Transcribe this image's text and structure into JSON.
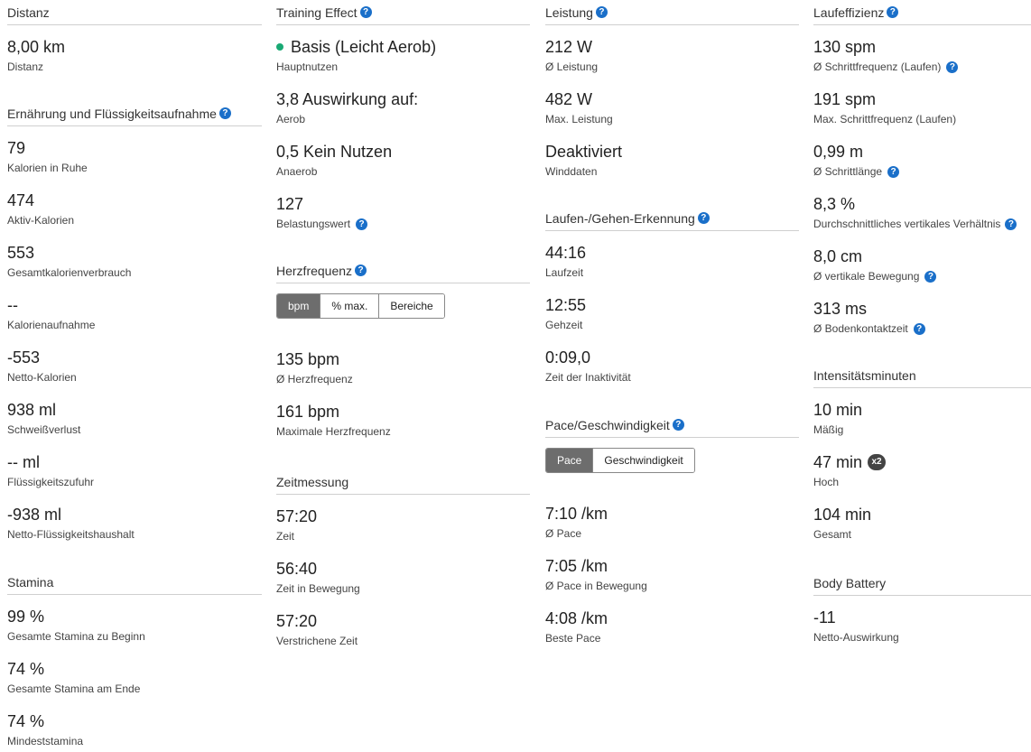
{
  "distanz": {
    "title": "Distanz",
    "items": [
      {
        "value": "8,00 km",
        "label": "Distanz"
      }
    ]
  },
  "ernaehrung": {
    "title": "Ernährung und Flüssigkeitsaufnahme",
    "items": [
      {
        "value": "79",
        "label": "Kalorien in Ruhe"
      },
      {
        "value": "474",
        "label": "Aktiv-Kalorien"
      },
      {
        "value": "553",
        "label": "Gesamtkalorienverbrauch"
      },
      {
        "value": "--",
        "label": "Kalorienaufnahme"
      },
      {
        "value": "-553",
        "label": "Netto-Kalorien"
      },
      {
        "value": "938 ml",
        "label": "Schweißverlust"
      },
      {
        "value": "-- ml",
        "label": "Flüssigkeitszufuhr"
      },
      {
        "value": "-938 ml",
        "label": "Netto-Flüssigkeitshaushalt"
      }
    ]
  },
  "stamina": {
    "title": "Stamina",
    "items": [
      {
        "value": "99 %",
        "label": "Gesamte Stamina zu Beginn"
      },
      {
        "value": "74 %",
        "label": "Gesamte Stamina am Ende"
      },
      {
        "value": "74 %",
        "label": "Mindeststamina"
      }
    ]
  },
  "training_effect": {
    "title": "Training Effect",
    "items": [
      {
        "value": "Basis (Leicht Aerob)",
        "label": "Hauptnutzen"
      },
      {
        "value": "3,8 Auswirkung auf:",
        "label": "Aerob"
      },
      {
        "value": "0,5 Kein Nutzen",
        "label": "Anaerob"
      },
      {
        "value": "127",
        "label": "Belastungswert"
      }
    ]
  },
  "herzfrequenz": {
    "title": "Herzfrequenz",
    "toggle": [
      "bpm",
      "% max.",
      "Bereiche"
    ],
    "items": [
      {
        "value": "135 bpm",
        "label": "Ø Herzfrequenz"
      },
      {
        "value": "161 bpm",
        "label": "Maximale Herzfrequenz"
      }
    ]
  },
  "zeitmessung": {
    "title": "Zeitmessung",
    "items": [
      {
        "value": "57:20",
        "label": "Zeit"
      },
      {
        "value": "56:40",
        "label": "Zeit in Bewegung"
      },
      {
        "value": "57:20",
        "label": "Verstrichene Zeit"
      }
    ]
  },
  "leistung": {
    "title": "Leistung",
    "items": [
      {
        "value": "212 W",
        "label": "Ø Leistung"
      },
      {
        "value": "482 W",
        "label": "Max. Leistung"
      },
      {
        "value": "Deaktiviert",
        "label": "Winddaten"
      }
    ]
  },
  "laufen_gehen": {
    "title": "Laufen-/Gehen-Erkennung",
    "items": [
      {
        "value": "44:16",
        "label": "Laufzeit"
      },
      {
        "value": "12:55",
        "label": "Gehzeit"
      },
      {
        "value": "0:09,0",
        "label": "Zeit der Inaktivität"
      }
    ]
  },
  "pace": {
    "title": "Pace/Geschwindigkeit",
    "toggle": [
      "Pace",
      "Geschwindigkeit"
    ],
    "items": [
      {
        "value": "7:10 /km",
        "label": "Ø Pace"
      },
      {
        "value": "7:05 /km",
        "label": "Ø Pace in Bewegung"
      },
      {
        "value": "4:08 /km",
        "label": "Beste Pace"
      }
    ]
  },
  "laufeffizienz": {
    "title": "Laufeffizienz",
    "items": [
      {
        "value": "130 spm",
        "label": "Ø Schrittfrequenz (Laufen)"
      },
      {
        "value": "191 spm",
        "label": "Max. Schrittfrequenz (Laufen)"
      },
      {
        "value": "0,99 m",
        "label": "Ø Schrittlänge"
      },
      {
        "value": "8,3 %",
        "label": "Durchschnittliches vertikales Verhältnis"
      },
      {
        "value": "8,0 cm",
        "label": "Ø vertikale Bewegung"
      },
      {
        "value": "313 ms",
        "label": "Ø Bodenkontaktzeit"
      }
    ]
  },
  "intensitaet": {
    "title": "Intensitätsminuten",
    "badge": "x2",
    "items": [
      {
        "value": "10 min",
        "label": "Mäßig"
      },
      {
        "value": "47 min",
        "label": "Hoch"
      },
      {
        "value": "104 min",
        "label": "Gesamt"
      }
    ]
  },
  "body_battery": {
    "title": "Body Battery",
    "items": [
      {
        "value": "-11",
        "label": "Netto-Auswirkung"
      }
    ]
  },
  "help_glyph": "?",
  "colors": {
    "accent_blue": "#1a6fc9",
    "aerob_green": "#19a974",
    "toggle_active": "#6d6d6d"
  }
}
